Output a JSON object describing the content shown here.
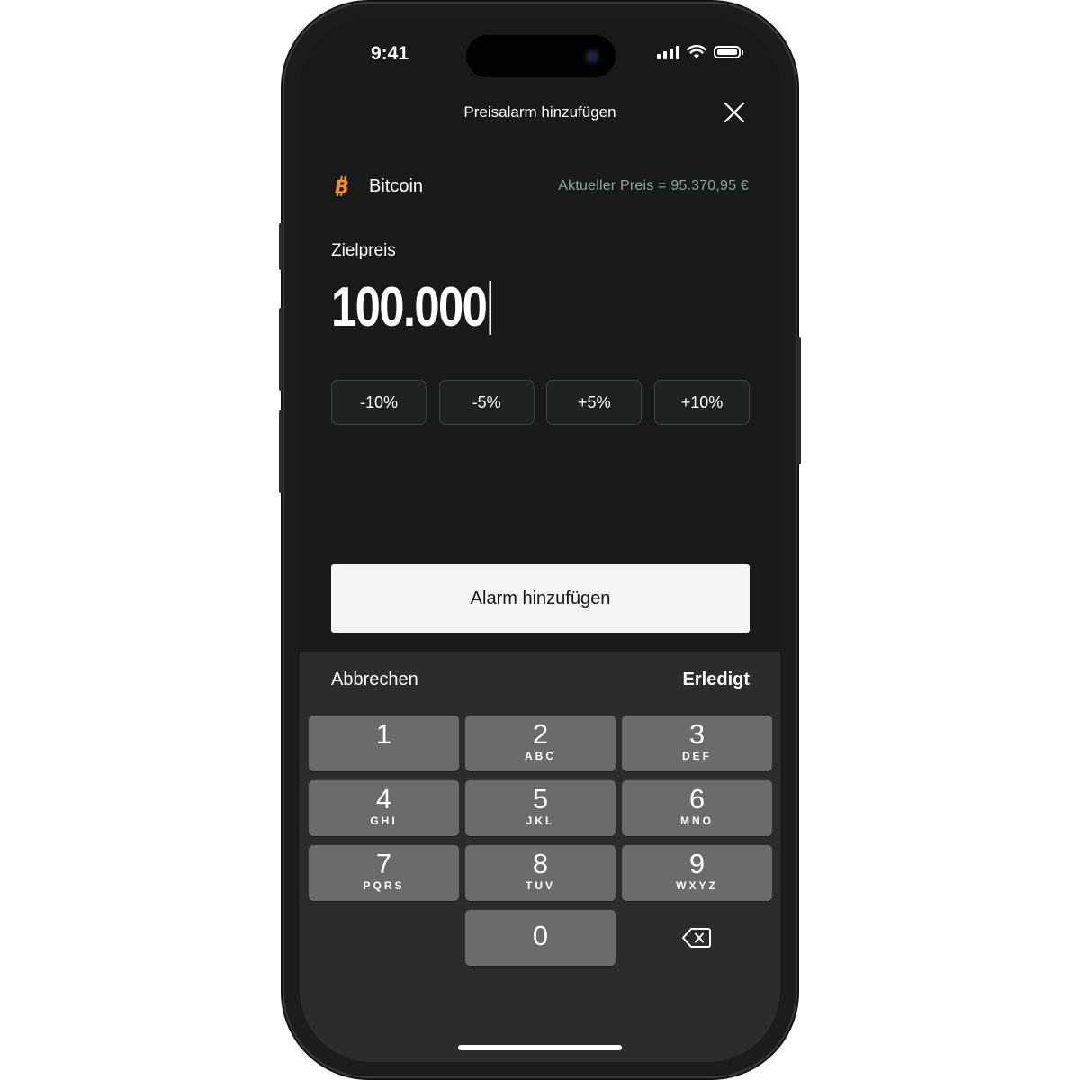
{
  "status_bar": {
    "time": "9:41"
  },
  "header": {
    "title": "Preisalarm hinzufügen"
  },
  "coin": {
    "name": "Bitcoin",
    "current_price": "Aktueller Preis = 95.370,95 €"
  },
  "target": {
    "label": "Zielpreis",
    "value": "100.000"
  },
  "percent_buttons": [
    "-10%",
    "-5%",
    "+5%",
    "+10%"
  ],
  "submit": {
    "label": "Alarm hinzufügen"
  },
  "keyboard": {
    "cancel_label": "Abbrechen",
    "done_label": "Erledigt",
    "keys": [
      {
        "num": "1",
        "letters": ""
      },
      {
        "num": "2",
        "letters": "ABC"
      },
      {
        "num": "3",
        "letters": "DEF"
      },
      {
        "num": "4",
        "letters": "GHI"
      },
      {
        "num": "5",
        "letters": "JKL"
      },
      {
        "num": "6",
        "letters": "MNO"
      },
      {
        "num": "7",
        "letters": "PQRS"
      },
      {
        "num": "8",
        "letters": "TUV"
      },
      {
        "num": "9",
        "letters": "WXYZ"
      },
      {
        "num": "0",
        "letters": ""
      }
    ]
  },
  "colors": {
    "background": "#171a19",
    "accent_bitcoin": "#f7931a",
    "muted_price": "#8fa89a",
    "key": "#6b6b6b"
  }
}
